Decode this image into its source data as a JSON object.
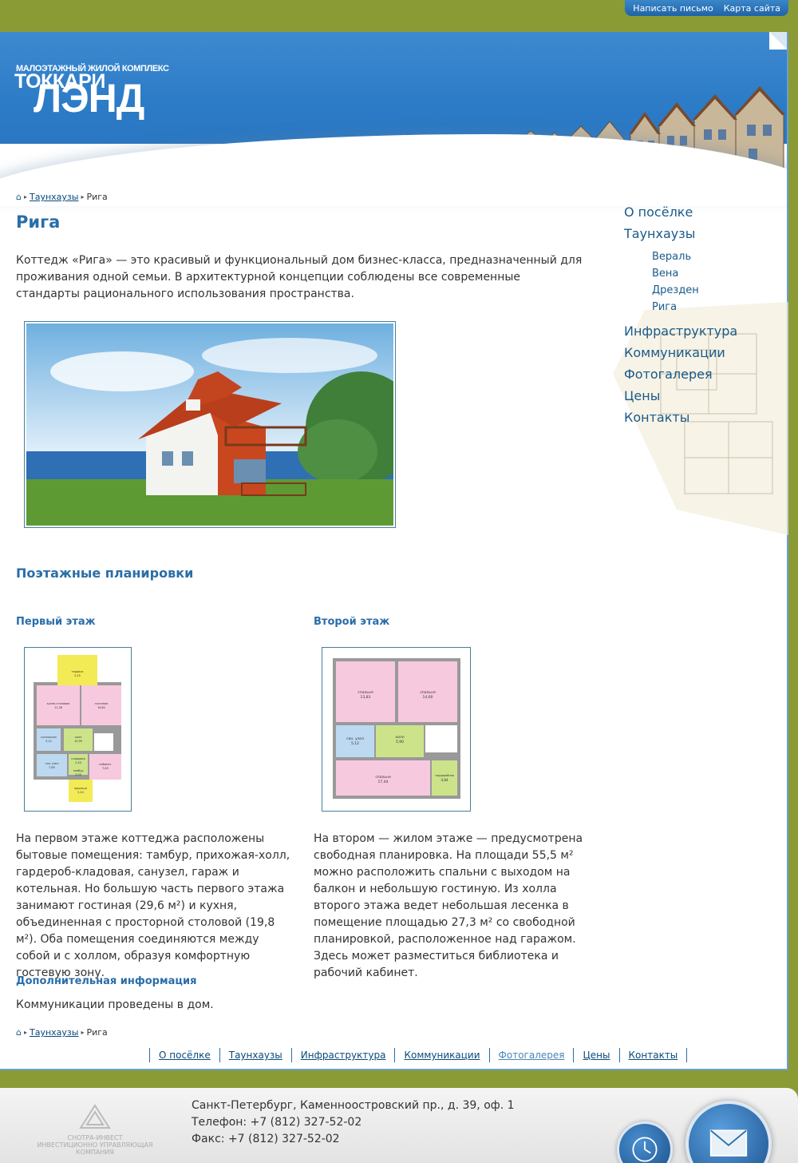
{
  "top_links": [
    "Написать письмо",
    "Карта сайта"
  ],
  "logo": {
    "subtitle": "МАЛОЭТАЖНЫЙ ЖИЛОЙ КОМПЛЕКС",
    "line1": "ТОККАРИ",
    "line2": "ЛЭНД"
  },
  "breadcrumbs": {
    "items": [
      "Таунхаузы",
      "Рига"
    ]
  },
  "page_title": "Рига",
  "intro": "Коттедж «Рига» —  это красивый и функциональный дом бизнес-класса, предназначенный для проживания одной семьи. В архитектурной концепции соблюдены все современные стандарты рационального использования пространства.",
  "plans_title": "Поэтажные планировки",
  "floor1": {
    "title": "Первый этаж",
    "rooms": [
      {
        "name": "терраса",
        "area": "2,25"
      },
      {
        "name": "кухня-столовая",
        "area": "11,38"
      },
      {
        "name": "гостиная",
        "area": "16,82"
      },
      {
        "name": "котельная",
        "area": "5,12"
      },
      {
        "name": "холл",
        "area": "10,99"
      },
      {
        "name": "кладовая",
        "area": "2,40"
      },
      {
        "name": "сан. узел",
        "area": "7,65"
      },
      {
        "name": "тамбур",
        "area": "2,00"
      },
      {
        "name": "кабинет",
        "area": "7,63"
      },
      {
        "name": "крыльцо",
        "area": "2,24"
      }
    ],
    "text": "На первом этаже коттеджа расположены бытовые помещения: тамбур, прихожая-холл, гардероб-кладовая, санузел, гараж и котельная. Но большую часть первого этажа занимают гостиная (29,6 м²) и кухня, объединенная с просторной столовой (19,8 м²). Оба помещения соединяются между собой и с холлом, образуя комфортную гостевую зону."
  },
  "floor2": {
    "title": "Второй этаж",
    "rooms": [
      {
        "name": "спальня",
        "area": "13,83"
      },
      {
        "name": "спальня",
        "area": "14,60"
      },
      {
        "name": "сан. узел",
        "area": "5,12"
      },
      {
        "name": "холл",
        "area": "5,90"
      },
      {
        "name": "спальня",
        "area": "17,44"
      },
      {
        "name": "гардеробная",
        "area": "4,84"
      }
    ],
    "text": "На втором — жилом этаже — предусмотрена свободная планировка. На площади 55,5 м² можно расположить спальни с выходом на балкон и небольшую гостиную. Из холла второго этажа ведет небольшая лесенка в помещение площадью 27,3 м² со свободной планировкой, расположенное над гаражом. Здесь может разместиться библиотека и рабочий кабинет."
  },
  "extra": {
    "title": "Дополнительная информация",
    "text": "Коммуникации проведены в дом."
  },
  "menu": {
    "items": [
      "О посёлке",
      "Таунхаузы"
    ],
    "subitems": [
      "Вераль",
      "Вена",
      "Дрезден",
      "Рига"
    ],
    "items2": [
      "Инфраструктура",
      "Коммуникации",
      "Фотогалерея",
      "Цены",
      "Контакты"
    ]
  },
  "bottom_nav": [
    "О посёлке",
    "Таунхаузы",
    "Инфраструктура",
    "Коммуникации",
    "Фотогалерея",
    "Цены",
    "Контакты"
  ],
  "footer": {
    "company_line1": "СНОТРА-ИНВЕСТ",
    "company_line2": "ИНВЕСТИЦИОННО УПРАВЛЯЮЩАЯ КОМПАНИЯ",
    "address": "Санкт-Петербург, Каменноостровский пр., д. 39, оф. 1",
    "phone": "Телефон: +7 (812) 327-52-02",
    "fax": "Факс: +7 (812) 327-52-02"
  },
  "colors": {
    "accent": "#2a6ea8",
    "link": "#0a4a7a",
    "outer_bg": "#8a9a35",
    "header_blue": "#2d7cc7"
  },
  "icons": [
    "home-icon",
    "mail-icon",
    "clock-icon",
    "chevron-right-icon"
  ]
}
